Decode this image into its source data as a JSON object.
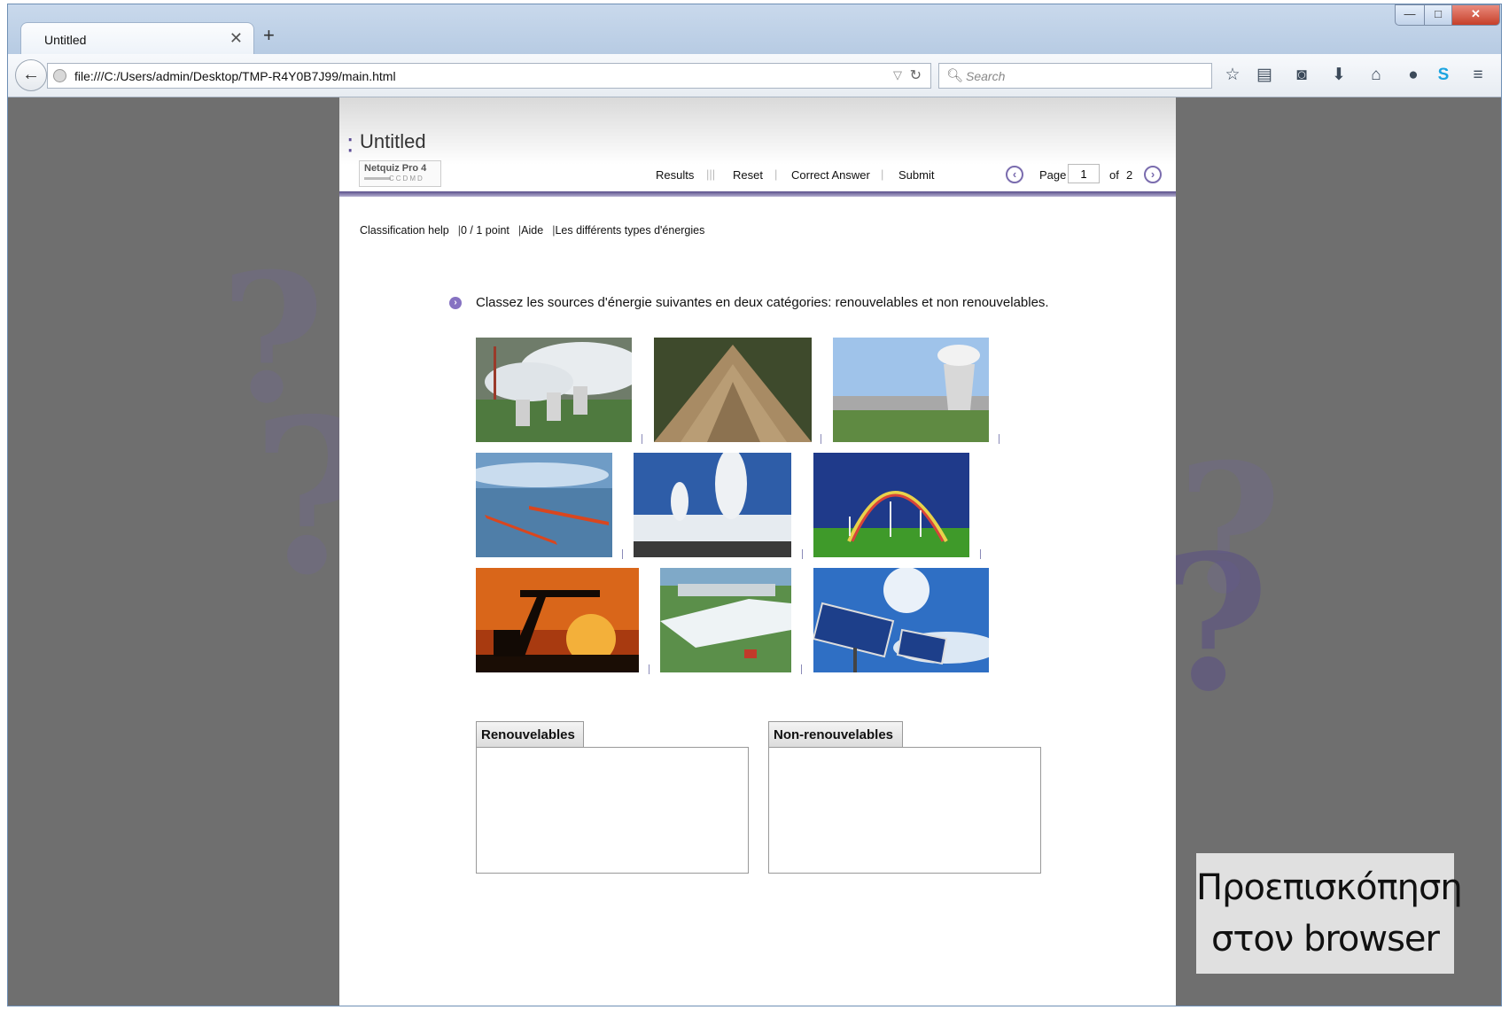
{
  "browser": {
    "tab_title": "Untitled",
    "url": "file:///C:/Users/admin/Desktop/TMP-R4Y0B7J99/main.html",
    "search_placeholder": "Search",
    "toolbar_icons": [
      "star-icon",
      "reading-list-icon",
      "pocket-icon",
      "download-icon",
      "home-icon",
      "chat-icon",
      "skype-icon",
      "menu-icon"
    ]
  },
  "quiz": {
    "title": "Untitled",
    "logo_text": "Netquiz Pro 4",
    "logo_sub": "CCDMD",
    "header_links": [
      "Results",
      "Reset",
      "Correct Answer",
      "Submit"
    ],
    "page_label": "Page",
    "page_value": "1",
    "of_label": "of",
    "page_total": "2",
    "info": [
      "Classification help",
      "0 / 1 point",
      "Aide",
      "Les différents types d'énergies"
    ],
    "question": "Classez les sources d'énergie suivantes en deux catégories: renouvelables et non renouvelables.",
    "images": [
      "coal-power-plant",
      "wood-chips",
      "nuclear-plant",
      "wave-energy",
      "geothermal",
      "wind-turbines-rainbow",
      "oil-pump",
      "hydro-dam",
      "solar-panels"
    ],
    "categories": [
      "Renouvelables",
      "Non-renouvelables"
    ]
  },
  "overlay": {
    "line1": "Προεπισκόπηση",
    "line2": "στον browser"
  }
}
